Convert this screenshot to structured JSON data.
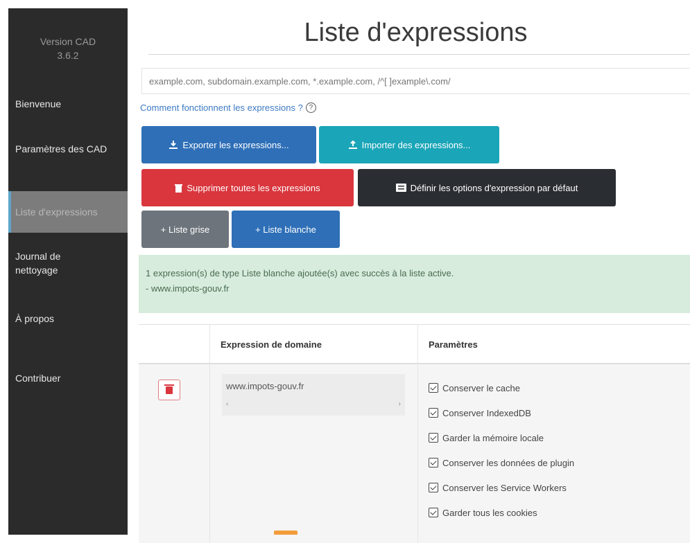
{
  "sidebar": {
    "version_line1": "Version CAD",
    "version_line2": "3.6.2",
    "items": [
      {
        "label": "Bienvenue"
      },
      {
        "label": "Paramètres des CAD"
      },
      {
        "label": "Liste d'expressions"
      },
      {
        "label": "Journal de nettoyage"
      },
      {
        "label": "À propos"
      },
      {
        "label": "Contribuer"
      }
    ]
  },
  "main": {
    "title": "Liste d'expressions",
    "search": {
      "placeholder": "example.com, subdomain.example.com, *.example.com, /^[ ]example\\.com/",
      "value": ""
    },
    "help_link": "Comment fonctionnent les expressions ?",
    "buttons": {
      "export": "Exporter les expressions...",
      "import": "Importer des expressions...",
      "delete_all": "Supprimer toutes les expressions",
      "default_options": "Définir les options d'expression par défaut",
      "greylist": "+ Liste grise",
      "whitelist": "+ Liste blanche"
    },
    "alert": {
      "line1": "1 expression(s) de type Liste blanche ajoutée(s) avec succès à la liste active.",
      "line2": "- www.impots-gouv.fr"
    },
    "table": {
      "headers": [
        "Expression de domaine",
        "Paramètres"
      ],
      "rows": [
        {
          "domain": "www.impots-gouv.fr",
          "params": [
            {
              "label": "Conserver le cache",
              "checked": true
            },
            {
              "label": "Conserver IndexedDB",
              "checked": true
            },
            {
              "label": "Garder la mémoire locale",
              "checked": true
            },
            {
              "label": "Conserver les données de plugin",
              "checked": true
            },
            {
              "label": "Conserver les Service Workers",
              "checked": true
            },
            {
              "label": "Garder tous les cookies",
              "checked": true
            }
          ]
        }
      ]
    }
  },
  "colors": {
    "sidebar_bg": "#2b2b2b",
    "primary": "#2e6fb7",
    "info": "#1ba5b8",
    "danger": "#d9363e",
    "dark": "#2a2e33",
    "secondary": "#6d747b",
    "success_bg": "#d7ecdc"
  },
  "icons": [
    "download-icon",
    "upload-icon",
    "trash-icon",
    "list-icon",
    "help-circle-icon",
    "checkbox-checked-icon"
  ]
}
